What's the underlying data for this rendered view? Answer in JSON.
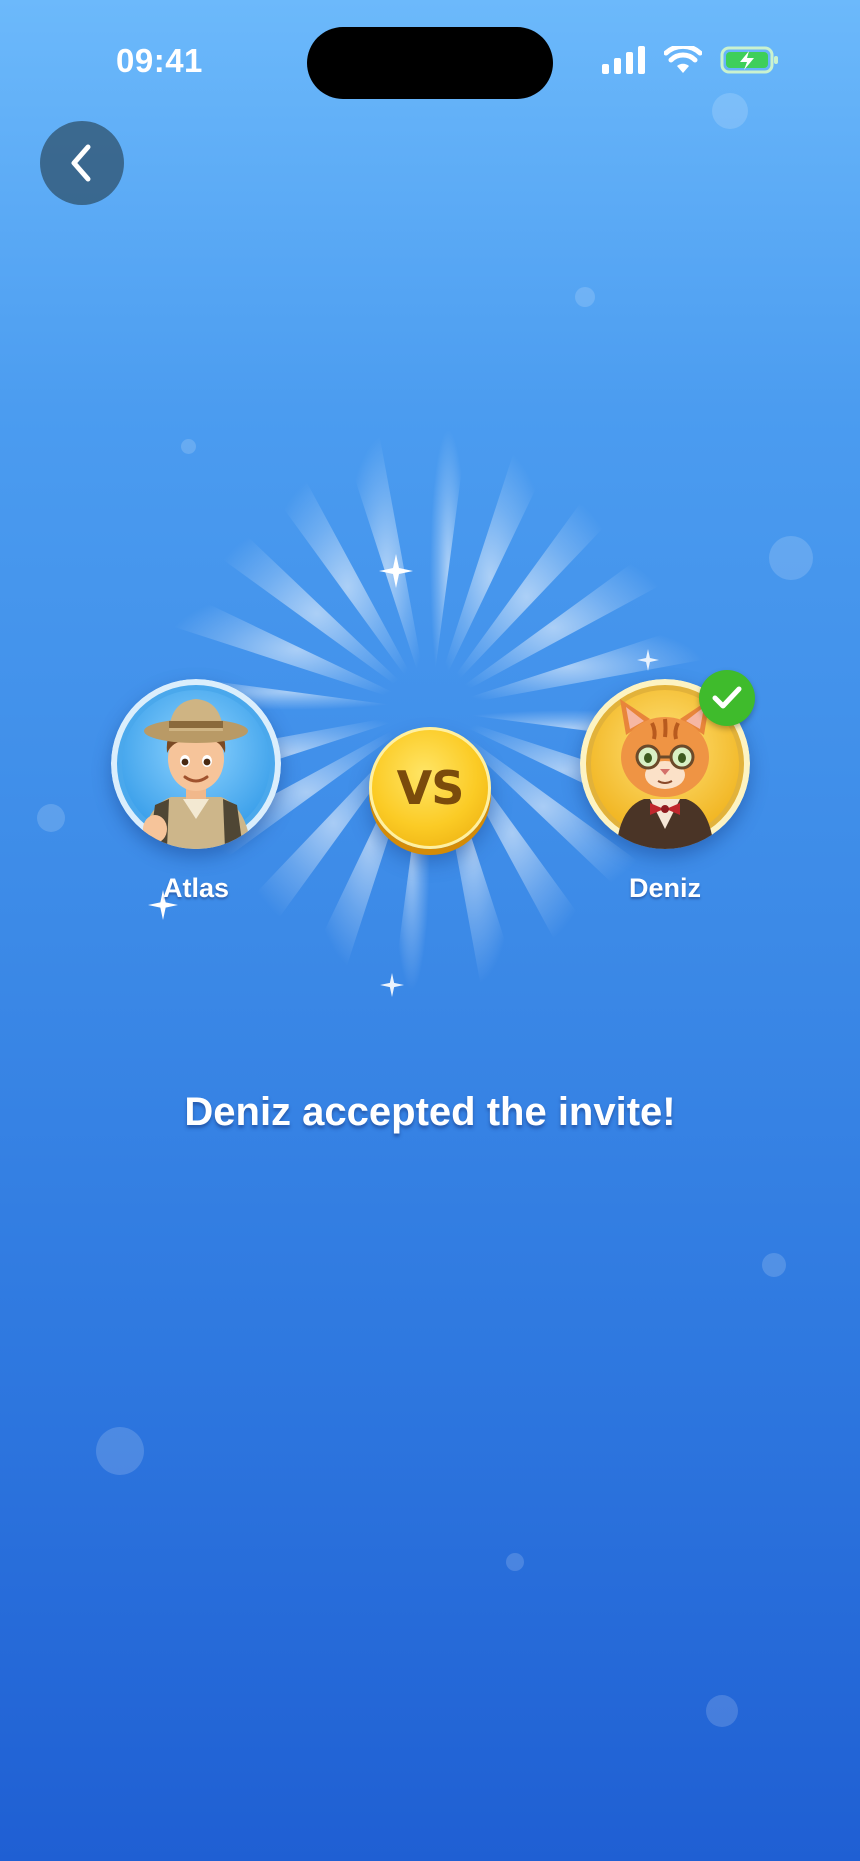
{
  "status_bar": {
    "time": "09:41",
    "icons": [
      "signal-icon",
      "wifi-icon",
      "battery-charging-icon"
    ]
  },
  "navigation": {
    "back_icon": "chevron-left-icon"
  },
  "players": {
    "left": {
      "name": "Atlas",
      "avatar": "explorer-boy-avatar"
    },
    "right": {
      "name": "Deniz",
      "avatar": "orange-cat-avatar",
      "status_icon": "check-icon"
    }
  },
  "versus": {
    "label": "VS"
  },
  "message": "Deniz accepted the invite!",
  "colors": {
    "background_top": "#6cb9fb",
    "background_bottom": "#1f5fd3",
    "coin": "#fbcb25",
    "coin_text": "#7a4b0c",
    "accepted_badge": "#3fbb2c",
    "atlas_ring": "#55b0f0",
    "deniz_ring": "#f3c62c"
  }
}
